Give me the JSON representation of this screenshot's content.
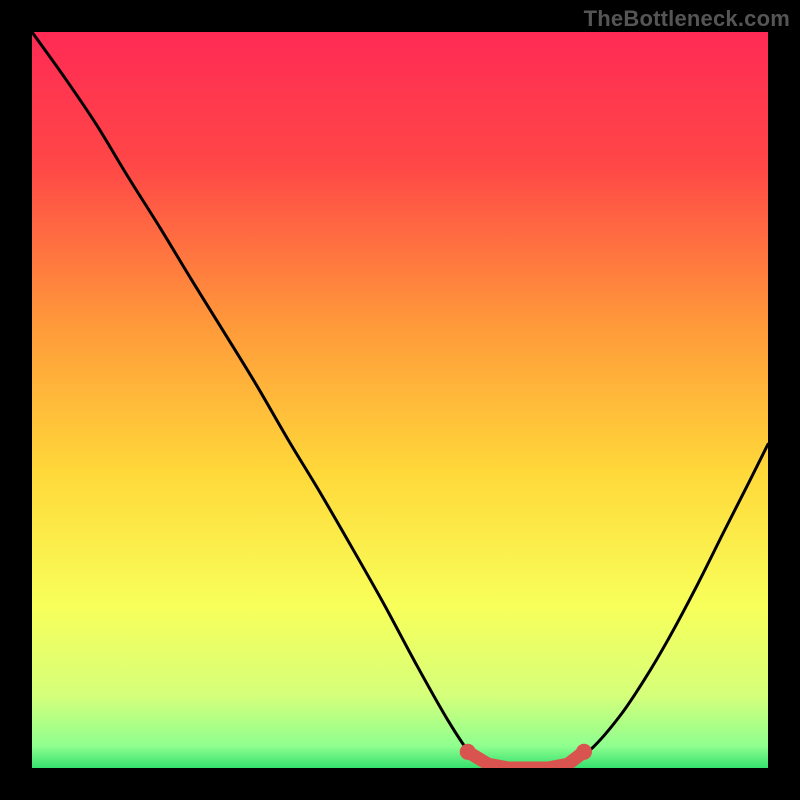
{
  "watermark": "TheBottleneck.com",
  "chart_data": {
    "type": "line",
    "title": "",
    "xlabel": "",
    "ylabel": "",
    "xlim": [
      0,
      100
    ],
    "ylim": [
      0,
      100
    ],
    "grid": false,
    "legend": false,
    "gradient_stops": [
      {
        "offset": 0.0,
        "color": "#ff2a55"
      },
      {
        "offset": 0.18,
        "color": "#ff4747"
      },
      {
        "offset": 0.4,
        "color": "#ff9a3a"
      },
      {
        "offset": 0.6,
        "color": "#ffd93a"
      },
      {
        "offset": 0.78,
        "color": "#f8ff5a"
      },
      {
        "offset": 0.9,
        "color": "#d6ff7a"
      },
      {
        "offset": 0.97,
        "color": "#8fff8f"
      },
      {
        "offset": 1.0,
        "color": "#35e06e"
      }
    ],
    "series": [
      {
        "name": "bottleneck-curve",
        "color": "#000000",
        "x": [
          0.0,
          4.3,
          8.7,
          13.0,
          17.4,
          21.7,
          26.1,
          30.4,
          34.8,
          39.1,
          43.5,
          47.8,
          52.2,
          56.5,
          59.8,
          62.0,
          65.2,
          69.0,
          72.8,
          76.1,
          79.9,
          83.2,
          86.4,
          90.2,
          94.0,
          97.3,
          100.0
        ],
        "y": [
          100.0,
          94.0,
          87.5,
          80.4,
          73.4,
          66.3,
          59.2,
          52.2,
          44.6,
          37.5,
          29.9,
          22.3,
          14.1,
          6.5,
          1.6,
          0.0,
          0.0,
          0.0,
          0.5,
          2.7,
          7.1,
          12.0,
          17.4,
          24.5,
          32.1,
          38.6,
          44.0
        ]
      },
      {
        "name": "optimal-band",
        "color": "#d9534f",
        "type": "scatter",
        "x": [
          59.2,
          62.0,
          64.7,
          67.4,
          70.1,
          72.8,
          75.0
        ],
        "y": [
          2.2,
          0.5,
          0.0,
          0.0,
          0.0,
          0.5,
          2.2
        ]
      }
    ]
  }
}
